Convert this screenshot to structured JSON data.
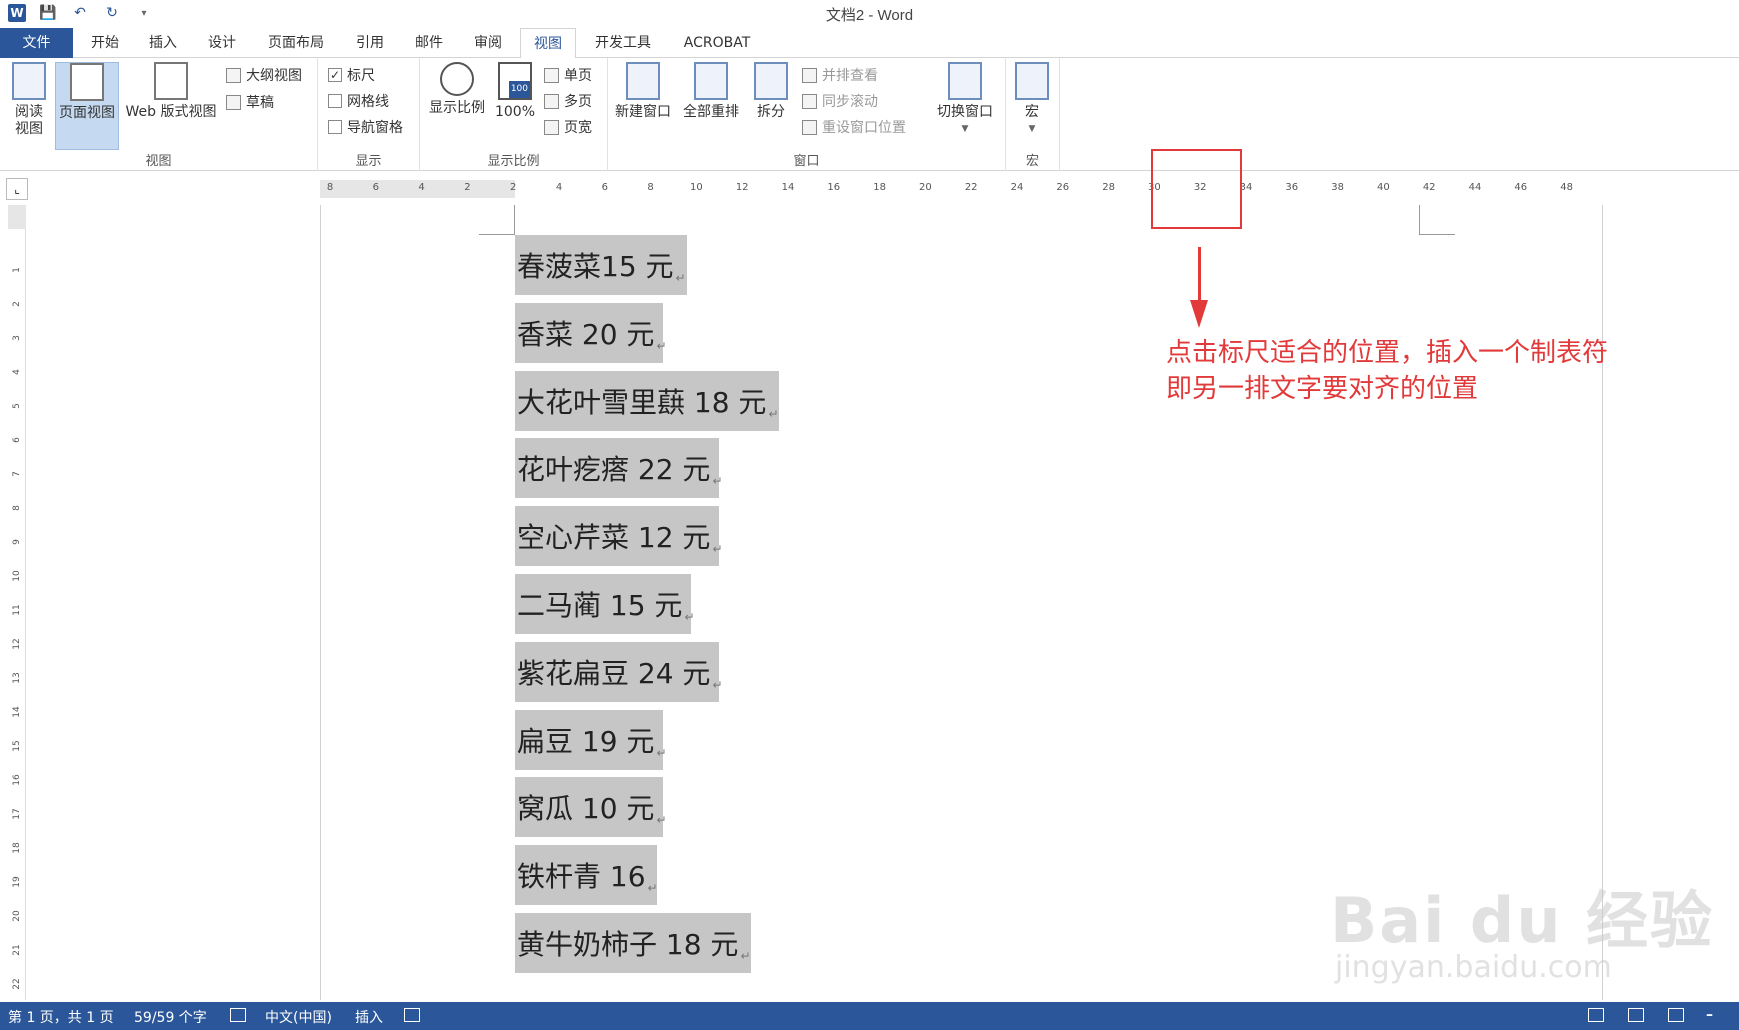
{
  "window": {
    "title": "文档2 - Word"
  },
  "tabs": [
    {
      "label": "文件"
    },
    {
      "label": "开始"
    },
    {
      "label": "插入"
    },
    {
      "label": "设计"
    },
    {
      "label": "页面布局"
    },
    {
      "label": "引用"
    },
    {
      "label": "邮件"
    },
    {
      "label": "审阅"
    },
    {
      "label": "视图"
    },
    {
      "label": "开发工具"
    },
    {
      "label": "ACROBAT"
    }
  ],
  "ribbon": {
    "views": {
      "label": "视图",
      "read_mode_l1": "阅读",
      "read_mode_l2": "视图",
      "print_layout": "页面视图",
      "web_layout": "Web 版式视图",
      "outline": "大纲视图",
      "draft": "草稿"
    },
    "show": {
      "label": "显示",
      "ruler": "标尺",
      "gridlines": "网格线",
      "nav_pane": "导航窗格"
    },
    "zoom": {
      "label": "显示比例",
      "zoom": "显示比例",
      "hundred": "100%",
      "hundred_icon": "100",
      "one_page": "单页",
      "multi_page": "多页",
      "page_width": "页宽"
    },
    "window": {
      "label": "窗口",
      "new_window": "新建窗口",
      "arrange_all": "全部重排",
      "split": "拆分",
      "side_by_side": "并排查看",
      "sync_scroll": "同步滚动",
      "reset_position": "重设窗口位置",
      "switch_windows": "切换窗口"
    },
    "macros": {
      "label": "宏",
      "macros": "宏"
    }
  },
  "ruler": {
    "ticks": [
      "8",
      "6",
      "4",
      "2",
      "2",
      "4",
      "6",
      "8",
      "10",
      "12",
      "14",
      "16",
      "18",
      "20",
      "22",
      "24",
      "26",
      "28",
      "30",
      "32",
      "34",
      "36",
      "38",
      "40",
      "42",
      "44",
      "46",
      "48"
    ],
    "vticks": [
      "1",
      "2",
      "3",
      "4",
      "5",
      "6",
      "7",
      "8",
      "9",
      "10",
      "11",
      "12",
      "13",
      "14",
      "15",
      "16",
      "17",
      "18",
      "19",
      "20",
      "21",
      "22"
    ]
  },
  "document": {
    "lines": [
      "春菠菜15 元",
      "香菜 20 元",
      "大花叶雪里蕻 18 元",
      "花叶疙瘩 22 元",
      "空心芹菜 12 元",
      "二马蔺 15 元",
      "紫花扁豆 24 元",
      "扁豆 19 元",
      "窝瓜 10 元",
      "铁杆青 16",
      "黄牛奶柿子 18 元"
    ],
    "pilcrow": "↵"
  },
  "annotation": {
    "line1": "点击标尺适合的位置，插入一个制表符",
    "line2": "即另一排文字要对齐的位置"
  },
  "watermark": {
    "main": "Bai du 经验",
    "sub": "jingyan.baidu.com"
  },
  "statusbar": {
    "page": "第 1 页，共 1 页",
    "words": "59/59 个字",
    "language": "中文(中国)",
    "mode": "插入"
  },
  "colors": {
    "accent": "#2b579a",
    "annotation": "#e23a3a",
    "selection": "#c6c6c6"
  }
}
